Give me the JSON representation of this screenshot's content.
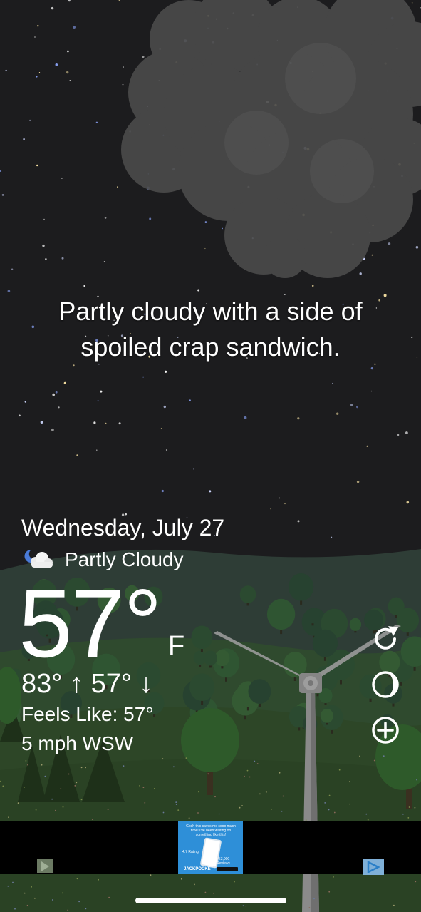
{
  "tagline": {
    "line1": "Partly cloudy with a side of",
    "line2": "spoiled crap sandwich."
  },
  "current": {
    "date": "Wednesday, July 27",
    "condition": "Partly Cloudy",
    "condition_icon": "partly-cloudy-night-icon",
    "temperature": "57°",
    "unit": "F",
    "high_low": "83° ↑ 57° ↓",
    "feels_like": "Feels Like: 57°",
    "wind": "5 mph WSW"
  },
  "actions": [
    {
      "name": "refresh-icon"
    },
    {
      "name": "moon-phase-icon"
    },
    {
      "name": "add-icon"
    }
  ],
  "ad": {
    "headline": "Gosh this saves me sooo much time! I've been waiting on something like this!",
    "rating": "4.7 Rating",
    "reviews": "+53,000 Reviews",
    "brand": "JACKPOCKET"
  },
  "colors": {
    "sky": "#1c1c1e",
    "hill_back": "#2e3d36",
    "hill_mid": "#2f4a2e",
    "hill_front": "#2d4627",
    "ad_blue": "#2e8fd8"
  }
}
